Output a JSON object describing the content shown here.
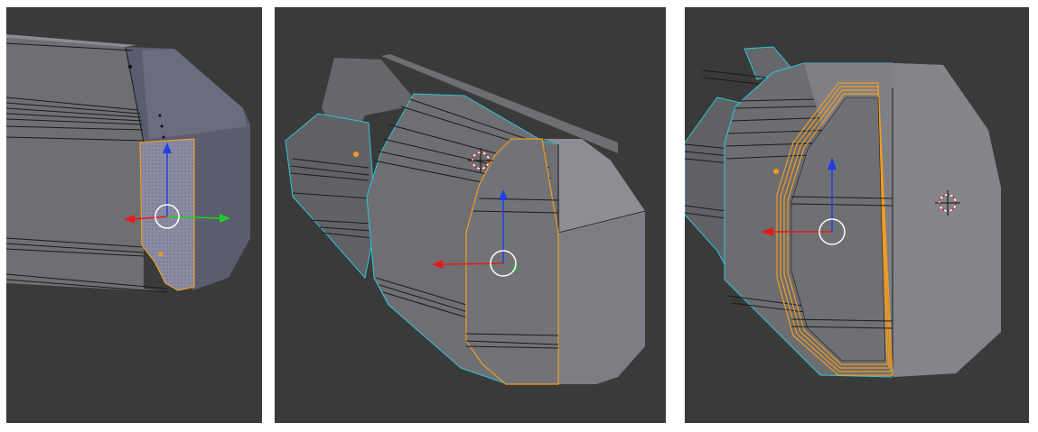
{
  "viewports": [
    {
      "label": "",
      "mode": "edit-mode-face-selected",
      "gizmo": "translate-manipulator",
      "show_3d_cursor": false
    },
    {
      "label": "",
      "mode": "edit-mode-face-selected",
      "gizmo": "translate-manipulator",
      "show_3d_cursor": true
    },
    {
      "label": "",
      "mode": "edit-mode-bevel-loops",
      "gizmo": "translate-manipulator",
      "show_3d_cursor": true
    }
  ],
  "colors": {
    "viewport_bg": "#3a3a3a",
    "mesh_front": "#6e6f72",
    "mesh_light": "#8c8d92",
    "mesh_dark": "#505155",
    "mesh_edge": "#1a1a1a",
    "selection": "#f29c1f",
    "selected_fill": "#8a8aa0",
    "boundary_edge": "#29c7d8",
    "axis_x": "#e51b1b",
    "axis_y": "#1fcf1f",
    "axis_z": "#1f3fe6",
    "gizmo_ring": "#ffffff",
    "origin_dot": "#f29c1f"
  }
}
